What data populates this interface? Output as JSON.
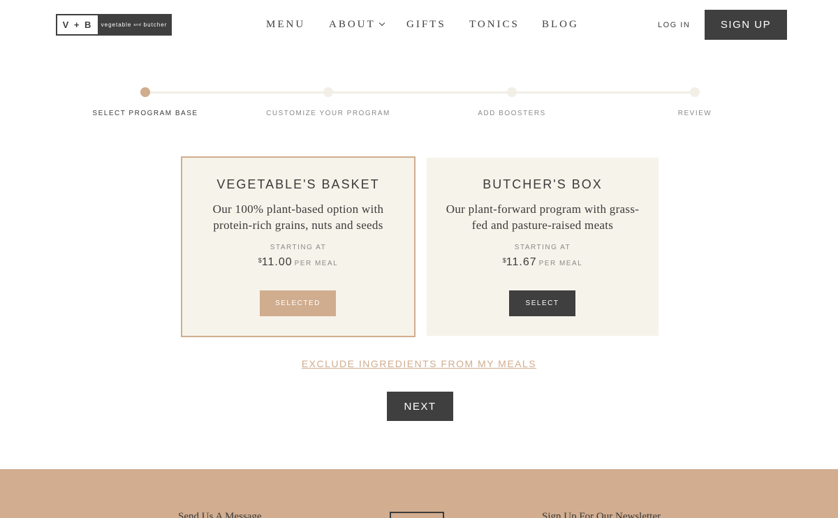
{
  "header": {
    "logo_mark": "V + B",
    "logo_text_1": "vegetable",
    "logo_text_and": "and",
    "logo_text_2": "butcher",
    "nav": {
      "menu": "MENU",
      "about": "ABOUT",
      "gifts": "GIFTS",
      "tonics": "TONICS",
      "blog": "BLOG"
    },
    "login": "LOG IN",
    "signup": "SIGN UP"
  },
  "stepper": {
    "current_step": 1,
    "steps": [
      {
        "label": "SELECT PROGRAM BASE"
      },
      {
        "label": "CUSTOMIZE YOUR PROGRAM"
      },
      {
        "label": "ADD BOOSTERS"
      },
      {
        "label": "REVIEW"
      }
    ]
  },
  "programs": [
    {
      "title": "VEGETABLE'S BASKET",
      "description": "Our 100% plant-based option with protein-rich grains, nuts and seeds",
      "starting_label": "STARTING AT",
      "currency": "$",
      "price": "11.00",
      "per": "PER MEAL",
      "button": "SELECTED",
      "selected": true
    },
    {
      "title": "BUTCHER'S BOX",
      "description": "Our plant-forward program with grass-fed and pasture-raised meats",
      "starting_label": "STARTING AT",
      "currency": "$",
      "price": "11.67",
      "per": "PER MEAL",
      "button": "SELECT",
      "selected": false
    }
  ],
  "exclude_link": "EXCLUDE INGREDIENTS FROM MY MEALS",
  "next_button": "NEXT",
  "footer": {
    "left_heading": "Send Us A Message",
    "right_heading": "Sign Up For Our Newsletter"
  },
  "colors": {
    "accent": "#d0ad8f",
    "dark": "#3f3f3f",
    "card_bg": "#f6f3ea",
    "footer_bg": "#d2ad8f"
  }
}
